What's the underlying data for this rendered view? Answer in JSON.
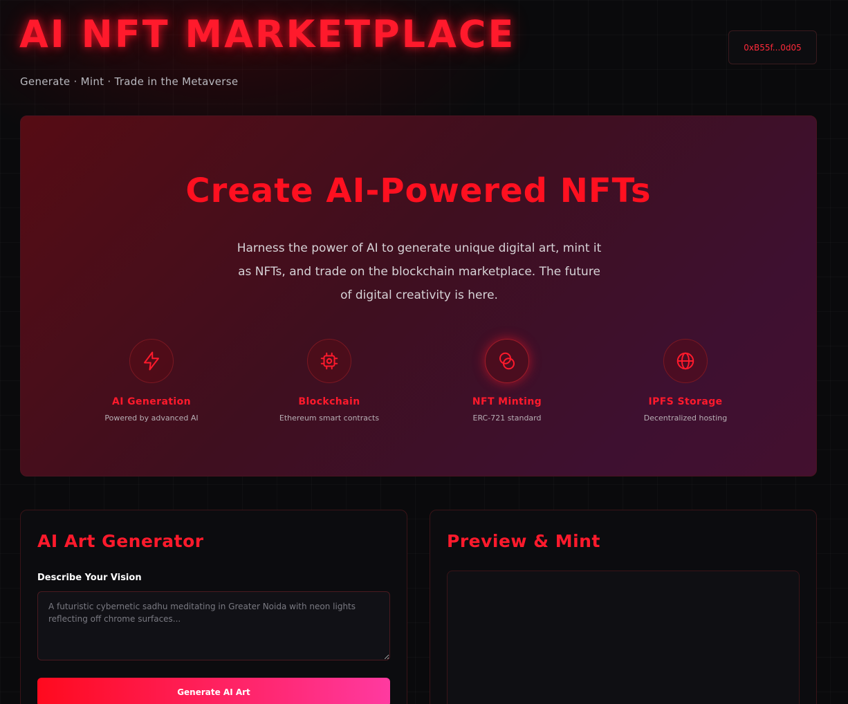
{
  "header": {
    "title": "AI NFT MARKETPLACE",
    "subtitle": "Generate · Mint · Trade in the Metaverse",
    "wallet_address": "0xB55f...0d05"
  },
  "hero": {
    "title": "Create AI-Powered NFTs",
    "description": "Harness the power of AI to generate unique digital art, mint it as NFTs, and trade on the blockchain marketplace. The future of digital creativity is here.",
    "features": [
      {
        "icon": "lightning-icon",
        "name": "AI Generation",
        "desc": "Powered by advanced AI"
      },
      {
        "icon": "chip-icon",
        "name": "Blockchain",
        "desc": "Ethereum smart contracts"
      },
      {
        "icon": "coins-icon",
        "name": "NFT Minting",
        "desc": "ERC-721 standard"
      },
      {
        "icon": "globe-icon",
        "name": "IPFS Storage",
        "desc": "Decentralized hosting"
      }
    ]
  },
  "generator": {
    "title": "AI Art Generator",
    "prompt_label": "Describe Your Vision",
    "prompt_value": "",
    "prompt_placeholder": "A futuristic cybernetic sadhu meditating in Greater Noida with neon lights reflecting off chrome surfaces...",
    "button_label": "Generate AI Art"
  },
  "preview": {
    "title": "Preview & Mint"
  },
  "colors": {
    "accent": "#ff1a2c",
    "background": "#0a0a0c",
    "button_gradient_end": "#ff3aa0"
  }
}
